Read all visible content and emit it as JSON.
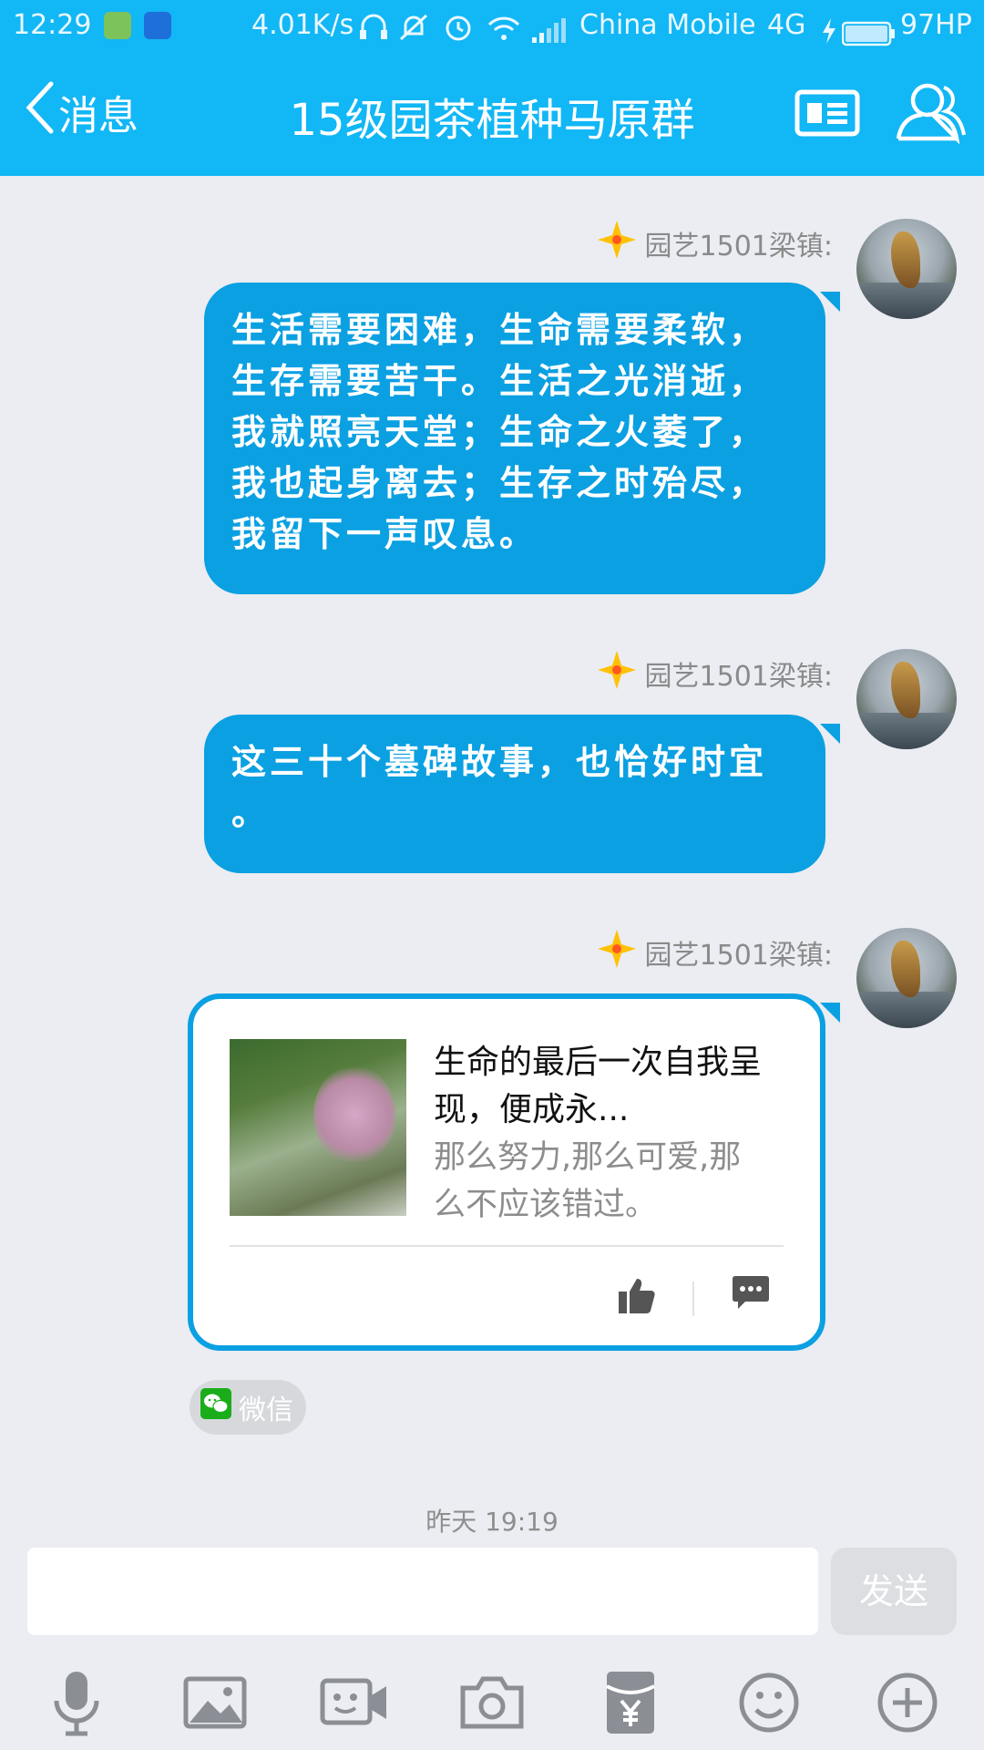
{
  "status_bar": {
    "time": "12:29",
    "speed": "4.01K/s",
    "carrier": "China Mobile",
    "network": "4G",
    "battery": "97HP"
  },
  "header": {
    "back_label": "消息",
    "title": "15级园茶植种马原群"
  },
  "messages": [
    {
      "sender": "园艺1501梁镇:",
      "lines": [
        "生活需要困难，生命需要柔软，",
        "生存需要苦干。生活之光消逝，",
        "我就照亮天堂；生命之火萎了，",
        "我也起身离去；生存之时殆尽，",
        "我留下一声叹息。"
      ]
    },
    {
      "sender": "园艺1501梁镇:",
      "lines": [
        "这三十个墓碑故事，也恰好时宜",
        "。"
      ]
    },
    {
      "sender": "园艺1501梁镇:",
      "card": {
        "title_lines": [
          "生命的最后一次自我呈",
          "现，便成永..."
        ],
        "desc_lines": [
          "那么努力,那么可爱,那",
          "么不应该错过。"
        ],
        "source": "微信"
      }
    }
  ],
  "timestamp": "昨天 19:19",
  "composer": {
    "input_value": "",
    "send_label": "发送"
  },
  "toolbar_icons": [
    "microphone-icon",
    "image-icon",
    "video-call-icon",
    "camera-icon",
    "red-packet-icon",
    "emoji-icon",
    "plus-icon"
  ],
  "colors": {
    "header_bg": "#12b7f5",
    "bubble_bg": "#0ba0e2",
    "page_bg": "#ebedf2"
  }
}
